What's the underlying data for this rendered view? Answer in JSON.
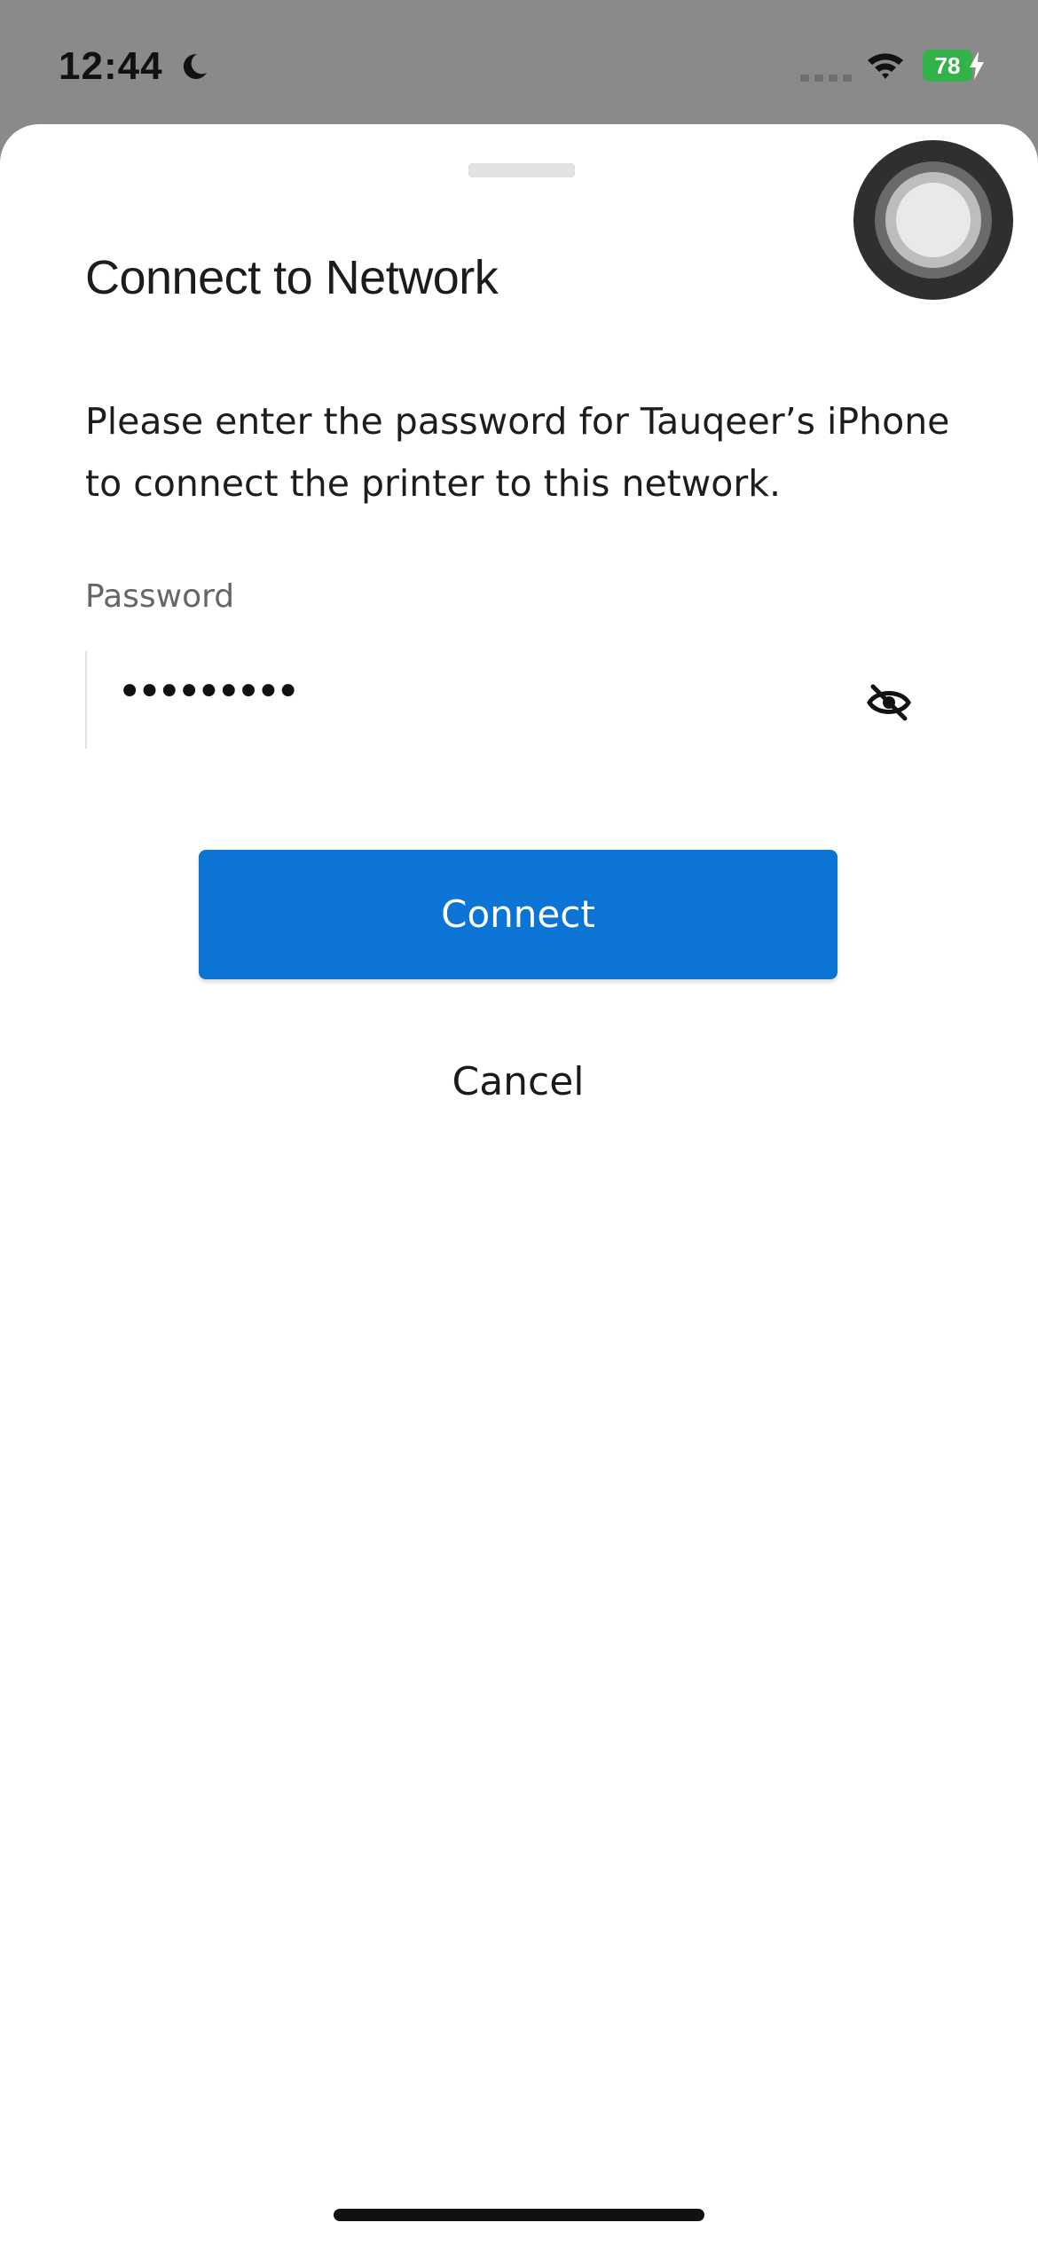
{
  "status_bar": {
    "time": "12:44",
    "battery_level": "78",
    "icons": [
      "moon-icon",
      "signal-icon",
      "wifi-icon",
      "bolt-icon"
    ],
    "battery_color": "#32b34a"
  },
  "sheet": {
    "title": "Connect to Network",
    "description": "Please enter the password for Tauqeer’s iPhone to connect the printer to this network.",
    "password_label": "Password",
    "password_value": "•••••••••",
    "connect_label": "Connect",
    "cancel_label": "Cancel",
    "accent_color": "#0b74d4"
  }
}
